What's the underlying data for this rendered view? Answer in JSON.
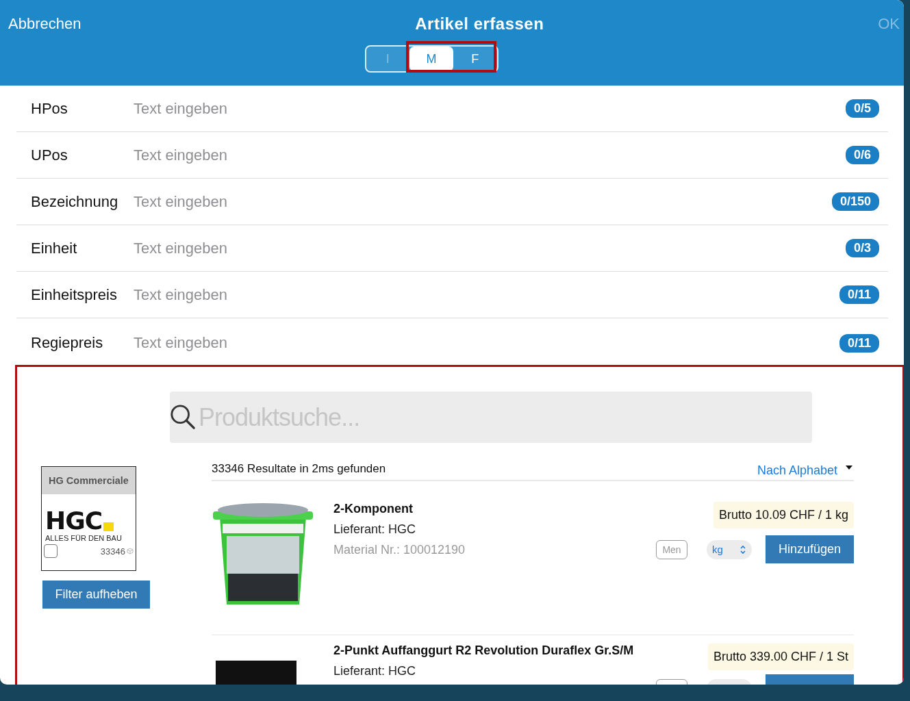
{
  "header": {
    "cancel": "Abbrechen",
    "title": "Artikel erfassen",
    "ok": "OK",
    "ok_disabled": true,
    "segments": [
      {
        "label": "I",
        "selected": false,
        "disabled": true
      },
      {
        "label": "M",
        "selected": true,
        "disabled": false
      },
      {
        "label": "F",
        "selected": false,
        "disabled": false
      }
    ]
  },
  "fields": [
    {
      "label": "HPos",
      "placeholder": "Text eingeben",
      "counter": "0/5"
    },
    {
      "label": "UPos",
      "placeholder": "Text eingeben",
      "counter": "0/6"
    },
    {
      "label": "Bezeichnung",
      "placeholder": "Text eingeben",
      "counter": "0/150"
    },
    {
      "label": "Einheit",
      "placeholder": "Text eingeben",
      "counter": "0/3"
    },
    {
      "label": "Einheitspreis",
      "placeholder": "Text eingeben",
      "counter": "0/11"
    },
    {
      "label": "Regiepreis",
      "placeholder": "Text eingeben",
      "counter": "0/11"
    }
  ],
  "search": {
    "placeholder": "Produktsuche..."
  },
  "filter": {
    "title": "HG Commerciale",
    "logo": "HGC",
    "slogan": "ALLES FÜR DEN BAU",
    "count": "33346",
    "checked": false,
    "button": "Filter aufheben"
  },
  "results": {
    "summary": "33346 Resultate in 2ms gefunden",
    "sort": "Nach Alphabet"
  },
  "products": [
    {
      "kind": "bucket",
      "name": "2-Komponent",
      "supplier": "Lieferant: HGC",
      "material": "Material Nr.: 100012190",
      "price": "Brutto 10.09 CHF / 1 kg",
      "quantity_placeholder": "Men",
      "unit": "kg",
      "add_button": "Hinzufügen"
    },
    {
      "kind": "logo",
      "name": "2-Punkt Auffanggurt R2 Revolution Duraflex Gr.S/M",
      "supplier": "Lieferant: HGC",
      "price": "Brutto 339.00 CHF / 1 St"
    }
  ]
}
